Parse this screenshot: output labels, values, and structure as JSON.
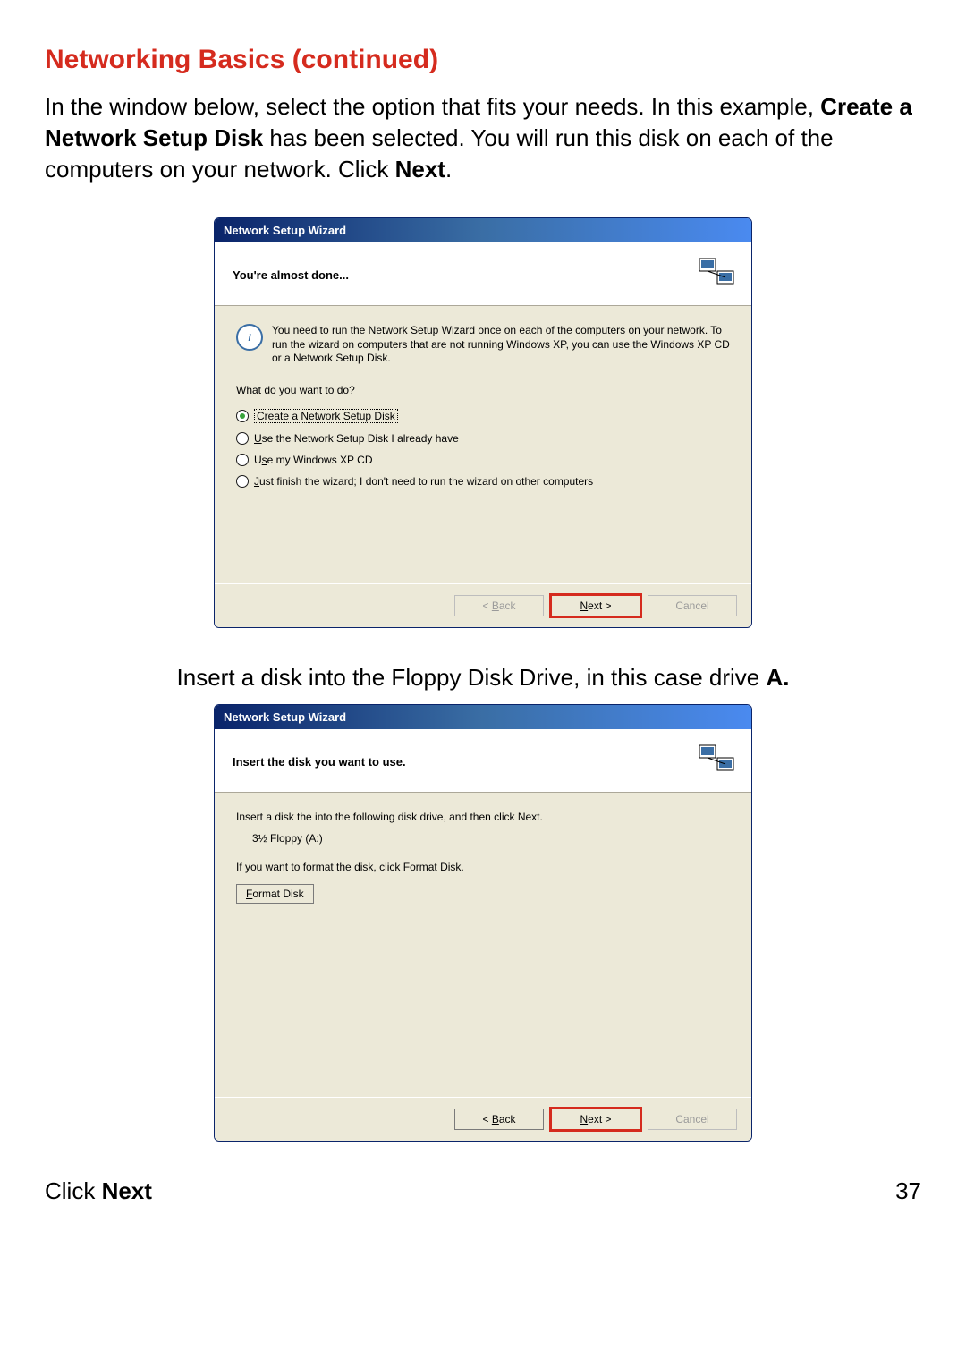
{
  "page": {
    "title": "Networking Basics (continued)",
    "intro_pre": "In the window below, select the option that fits your needs. In this example, ",
    "intro_bold": "Create a Network Setup Disk",
    "intro_post": " has been selected.  You will run this disk on each of the computers on your network. Click ",
    "intro_next": "Next",
    "intro_end": ".",
    "mid_pre": "Insert a disk into the Floppy Disk Drive, in this case drive ",
    "mid_bold": "A.",
    "click_label": "Click ",
    "click_bold": "Next",
    "page_number": "37"
  },
  "wiz1": {
    "title": "Network Setup Wizard",
    "header": "You're almost done...",
    "info": "You need to run the Network Setup Wizard once on each of the computers on your network. To run the wizard on computers that are not running Windows XP, you can use the Windows XP CD or a Network Setup Disk.",
    "question": "What do you want to do?",
    "options": {
      "o1_u": "C",
      "o1_rest": "reate a Network Setup Disk",
      "o2_u": "U",
      "o2_rest": "se the Network Setup Disk I already have",
      "o3_pre": "U",
      "o3_u": "s",
      "o3_rest": "e my Windows XP CD",
      "o4_u": "J",
      "o4_rest": "ust finish the wizard; I don't need to run the wizard on other computers"
    },
    "buttons": {
      "back_lt": "< ",
      "back_u": "B",
      "back_rest": "ack",
      "next_u": "N",
      "next_rest": "ext >",
      "cancel": "Cancel"
    }
  },
  "wiz2": {
    "title": "Network Setup Wizard",
    "header": "Insert the disk you want to use.",
    "line1": "Insert a disk the into the following disk drive, and then click Next.",
    "drive": "3½ Floppy (A:)",
    "line2": "If you want to format the disk, click Format Disk.",
    "format_u": "F",
    "format_rest": "ormat Disk",
    "buttons": {
      "back_lt": "< ",
      "back_u": "B",
      "back_rest": "ack",
      "next_u": "N",
      "next_rest": "ext >",
      "cancel": "Cancel"
    }
  }
}
